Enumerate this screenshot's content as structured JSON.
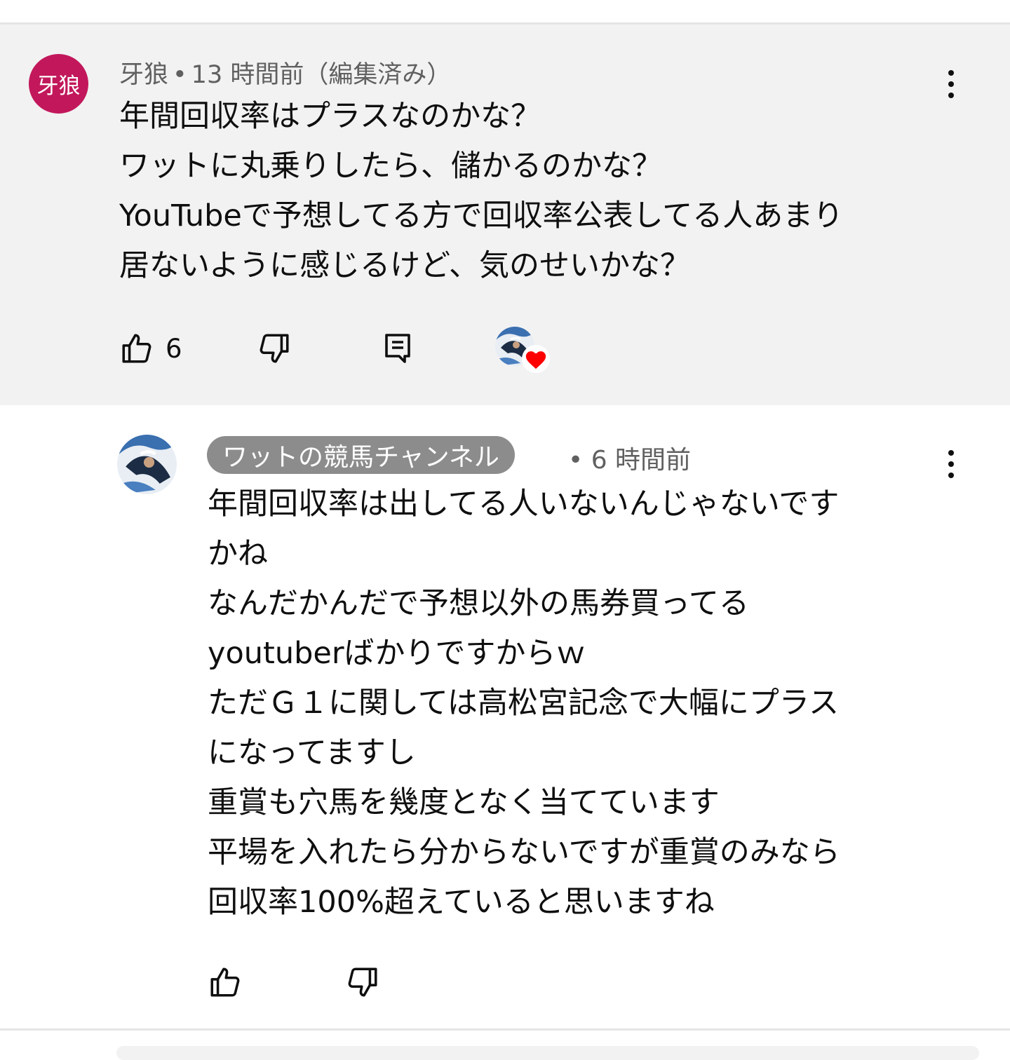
{
  "comment": {
    "avatar_text": "牙狼",
    "author": "牙狼",
    "separator": "•",
    "time": "13 時間前（編集済み）",
    "lines": [
      "年間回収率はプラスなのかな？",
      "ワットに丸乗りしたら、儲かるのかな？",
      "YouTubeで予想してる方で回収率公表してる人あまり",
      "居ないように感じるけど、気のせいかな？"
    ],
    "like_count": "6",
    "icons": {
      "like": "thumbs-up-icon",
      "dislike": "thumbs-down-icon",
      "reply": "reply-icon",
      "creator_heart": "creator-heart-icon",
      "menu": "more-vert-icon"
    },
    "colors": {
      "avatar_bg": "#c2185b",
      "heart": "#ff0000",
      "background": "#f2f2f2"
    }
  },
  "reply": {
    "channel_name": "ワットの競馬チャンネル",
    "separator": "•",
    "time": "6 時間前",
    "lines": [
      "年間回収率は出してる人いないんじゃないです",
      "かね",
      "なんだかんだで予想以外の馬券買ってる",
      "youtuberばかりですからｗ",
      "ただＧ１に関しては高松宮記念で大幅にプラス",
      "になってますし",
      "重賞も穴馬を幾度となく当てています",
      "平場を入れたら分からないですが重賞のみなら",
      "回収率100%超えていると思いますね"
    ],
    "colors": {
      "badge_bg": "#8c8c8c"
    }
  }
}
